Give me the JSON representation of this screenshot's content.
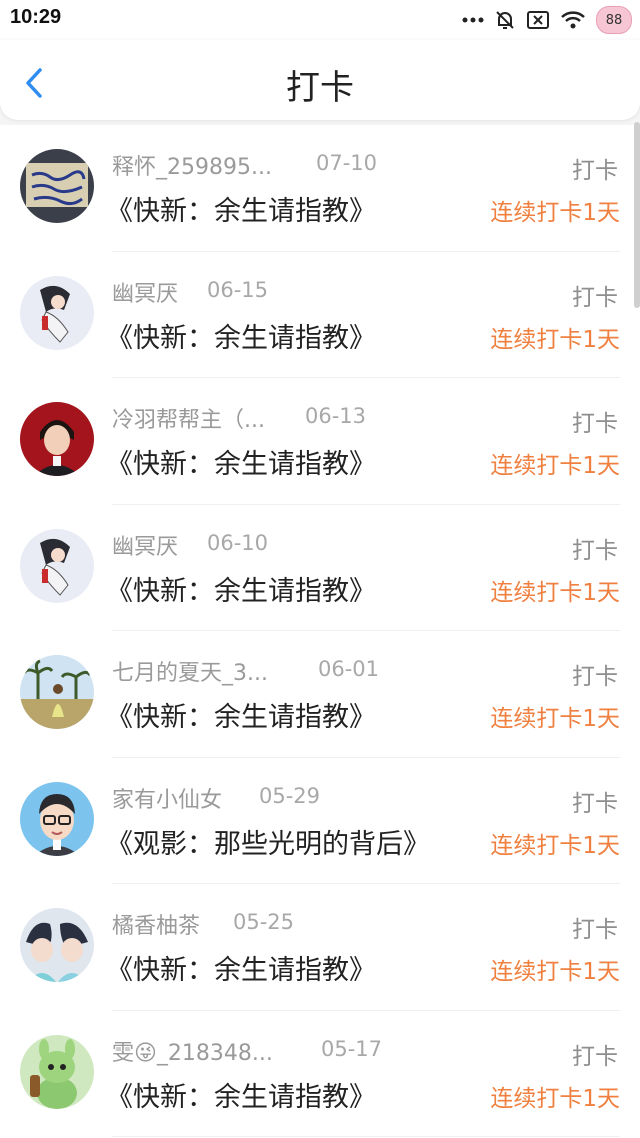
{
  "status_bar": {
    "time": "10:29",
    "battery": "88"
  },
  "header": {
    "title": "打卡"
  },
  "records": [
    {
      "name": "释怀_259895...",
      "date": "07-10",
      "book": "《快新：余生请指教》",
      "action": "打卡",
      "streak": "连续打卡1天"
    },
    {
      "name": "幽冥厌",
      "date": "06-15",
      "book": "《快新：余生请指教》",
      "action": "打卡",
      "streak": "连续打卡1天"
    },
    {
      "name": "冷羽帮帮主（...",
      "date": "06-13",
      "book": "《快新：余生请指教》",
      "action": "打卡",
      "streak": "连续打卡1天"
    },
    {
      "name": "幽冥厌",
      "date": "06-10",
      "book": "《快新：余生请指教》",
      "action": "打卡",
      "streak": "连续打卡1天"
    },
    {
      "name": "七月的夏天_3...",
      "date": "06-01",
      "book": "《快新：余生请指教》",
      "action": "打卡",
      "streak": "连续打卡1天"
    },
    {
      "name": "家有小仙女",
      "date": "05-29",
      "book": "《观影：那些光明的背后》",
      "action": "打卡",
      "streak": "连续打卡1天"
    },
    {
      "name": "橘香柚茶",
      "date": "05-25",
      "book": "《快新：余生请指教》",
      "action": "打卡",
      "streak": "连续打卡1天"
    },
    {
      "name": "雯😜_218348...",
      "date": "05-17",
      "book": "《快新：余生请指教》",
      "action": "打卡",
      "streak": "连续打卡1天"
    }
  ],
  "colors": {
    "accent": "#f08040",
    "back_arrow": "#2f8cf0"
  }
}
